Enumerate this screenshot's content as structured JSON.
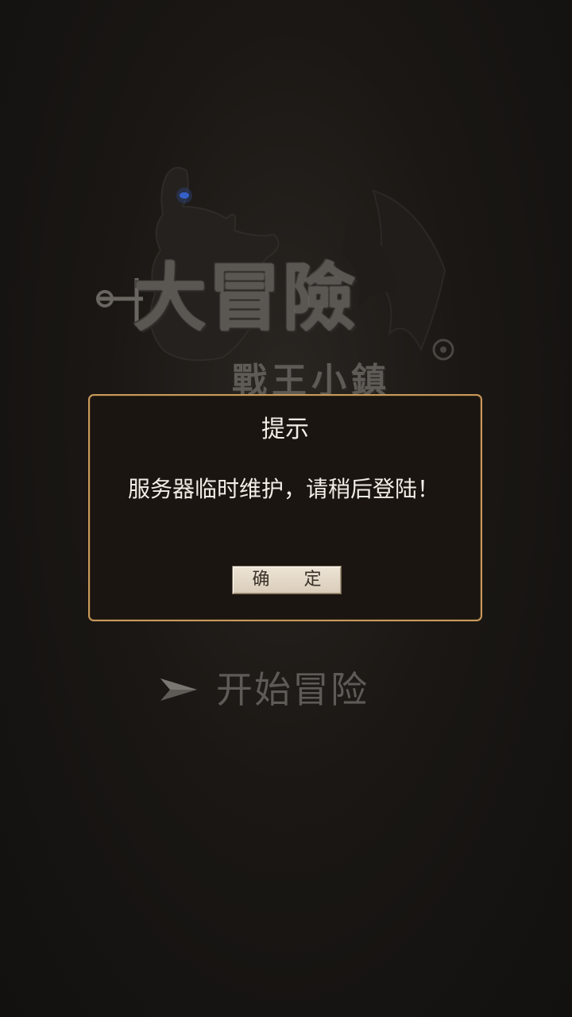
{
  "logo": {
    "title": "大冒險",
    "subtitle": "戰王小鎮"
  },
  "dialog": {
    "title": "提示",
    "message": "服务器临时维护，请稍后登陆！",
    "confirm_label": "确 定"
  },
  "start": {
    "label": "开始冒险",
    "icon": "arrow-right-icon"
  },
  "colors": {
    "dialog_border": "#c9995a",
    "dialog_bg": "#1a1511",
    "button_bg": "#e4d9c8",
    "background": "#141210"
  }
}
